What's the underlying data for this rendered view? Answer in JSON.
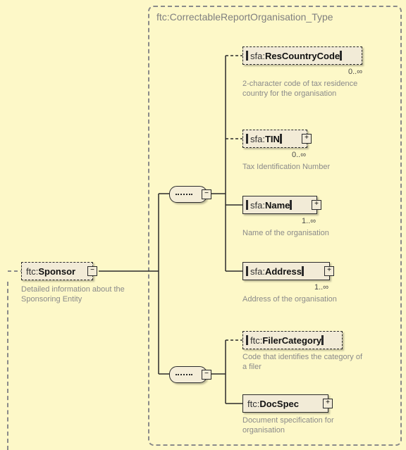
{
  "type_frame": {
    "title": "ftc:CorrectableReportOrganisation_Type"
  },
  "root": {
    "ns": "ftc:",
    "name": "Sponsor",
    "desc": "Detailed information about the Sponsoring Entity",
    "expander": "−"
  },
  "seq": {
    "upper_expander": "−",
    "lower_expander": "−"
  },
  "children": {
    "res_country": {
      "ns": "sfa:",
      "name": "ResCountryCode",
      "card": "0..∞",
      "desc": "2-character code of tax residence country for the organisation"
    },
    "tin": {
      "ns": "sfa:",
      "name": "TIN",
      "card": "0..∞",
      "desc": "Tax Identification Number",
      "expander": "+"
    },
    "name_el": {
      "ns": "sfa:",
      "name": "Name",
      "card": "1..∞",
      "desc": "Name of the organisation",
      "expander": "+"
    },
    "address": {
      "ns": "sfa:",
      "name": "Address",
      "card": "1..∞",
      "desc": "Address of the organisation",
      "expander": "+"
    },
    "filer": {
      "ns": "ftc:",
      "name": "FilerCategory",
      "desc": "Code that identifies the category of a filer"
    },
    "docspec": {
      "ns": "ftc:",
      "name": "DocSpec",
      "desc": "Document specification for organisation",
      "expander": "+"
    }
  }
}
